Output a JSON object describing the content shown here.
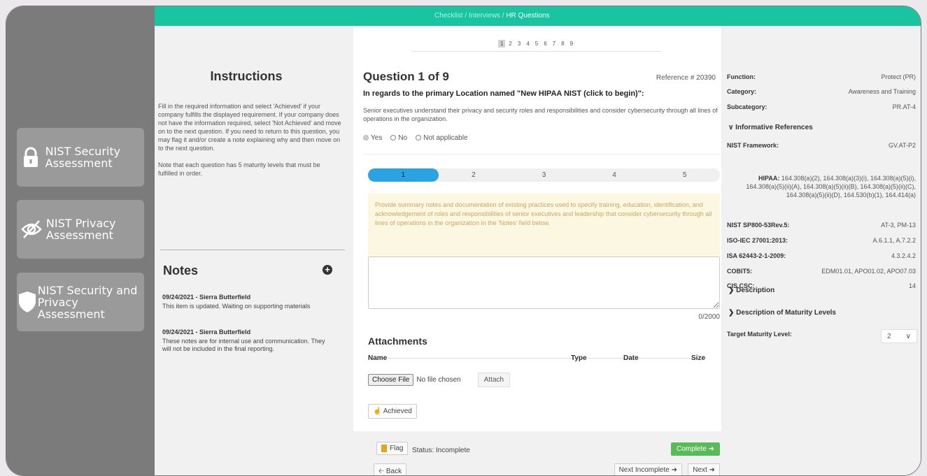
{
  "breadcrumb": {
    "a": "Checklist",
    "sep": "/",
    "b": "Interviews",
    "c": "HR Questions"
  },
  "nav": [
    {
      "label": "NIST Security Assessment",
      "icon": "lock-icon"
    },
    {
      "label": "NIST Privacy Assessment",
      "icon": "eye-slash-icon"
    },
    {
      "label": "NIST Security and Privacy Assessment",
      "icon": "shield-icon"
    }
  ],
  "instructions": {
    "title": "Instructions",
    "p1": "Fill in the required information and select 'Achieved' if your company fulfills the displayed requirement. If your company does not have the information required, select 'Not Achieved' and move on to the next question. If you need to return to this question, you may flag it and/or create a note explaining why and then move on to the next question.",
    "p2": "Note that each question has 5 maturity levels that must be fulfilled in order."
  },
  "notes": {
    "title": "Notes",
    "items": [
      {
        "header": "09/24/2021 - Sierra Butterfield",
        "text": "This item is updated. Waiting on supporting materials"
      },
      {
        "header": "09/24/2021 - Sierra Butterfield",
        "text": "These notes are for internal use and communication. They will not be included in the final reporting."
      }
    ]
  },
  "pager": [
    "1",
    "2",
    "3",
    "4",
    "5",
    "6",
    "7",
    "8",
    "9"
  ],
  "question": {
    "title": "Question 1 of 9",
    "reference": "Reference # 20390",
    "subtitle": "In regards to the primary Location named \"New HIPAA NIST (click to begin)\":",
    "description": "Senior executives understand their privacy and security roles and responsibilities and consider cybersecurity through all lines of operations in the organization.",
    "options": [
      "Yes",
      "No",
      "Not applicable"
    ],
    "selected": "Yes"
  },
  "maturity_levels": [
    "1",
    "2",
    "3",
    "4",
    "5"
  ],
  "info_text": "Provide summary notes and documentation of existing practices used to specify training, education, identification, and acknowledgement of roles and responsibilities of senior executives and leadership that consider cybersecurity through all lines of operations in the organization in the 'Notes' field below.",
  "counter": "0/2000",
  "attachments": {
    "title": "Attachments",
    "columns": [
      "Name",
      "Type",
      "Date",
      "Size"
    ],
    "choose_label": "Choose File",
    "no_file": "No file chosen",
    "attach_label": "Attach"
  },
  "achieved_label": "Achieved",
  "footer": {
    "flag": "Flag",
    "status": "Status: Incomplete",
    "complete": "Complete",
    "back": "Back",
    "next_incomplete": "Next Incomplete",
    "next": "Next"
  },
  "details": {
    "function_k": "Function:",
    "function_v": "Protect (PR)",
    "category_k": "Category:",
    "category_v": "Awareness and Training",
    "subcategory_k": "Subcategory:",
    "subcategory_v": "PR.AT-4",
    "inf_refs": "Informative References",
    "nist_k": "NIST Framework:",
    "nist_v": "GV.AT-P2",
    "hipaa_k": "HIPAA:",
    "hipaa_v": "164.308(a)(2), 164.308(a)(3)(i), 164.308(a)(5)(i), 164.308(a)(5)(ii)(A), 164.308(a)(5)(ii)(B), 164.308(a)(5)(ii)(C), 164.308(a)(5)(ii)(D), 164.530(b)(1), 164.414(a)",
    "sp800_k": "NIST SP800-53Rev.5:",
    "sp800_v": "AT-3, PM-13",
    "iso_k": "ISO-IEC 27001:2013:",
    "iso_v": "A.6.1.1, A.7.2.2",
    "isa_k": "ISA 62443-2-1-2009:",
    "isa_v": "4.3.2.4.2",
    "cobit_k": "COBIT5:",
    "cobit_v": "EDM01.01, APO01.02, APO07.03",
    "cis_k": "CIS CSC:",
    "cis_v": "14",
    "description": "Description",
    "desc_maturity": "Description of Maturity Levels",
    "target_k": "Target Maturity Level:",
    "target_v": "2"
  },
  "colors": {
    "accent": "#19c5a0",
    "sidebar": "#7b7b7b",
    "maturity_active": "#29a3e3",
    "complete": "#57bb57"
  }
}
